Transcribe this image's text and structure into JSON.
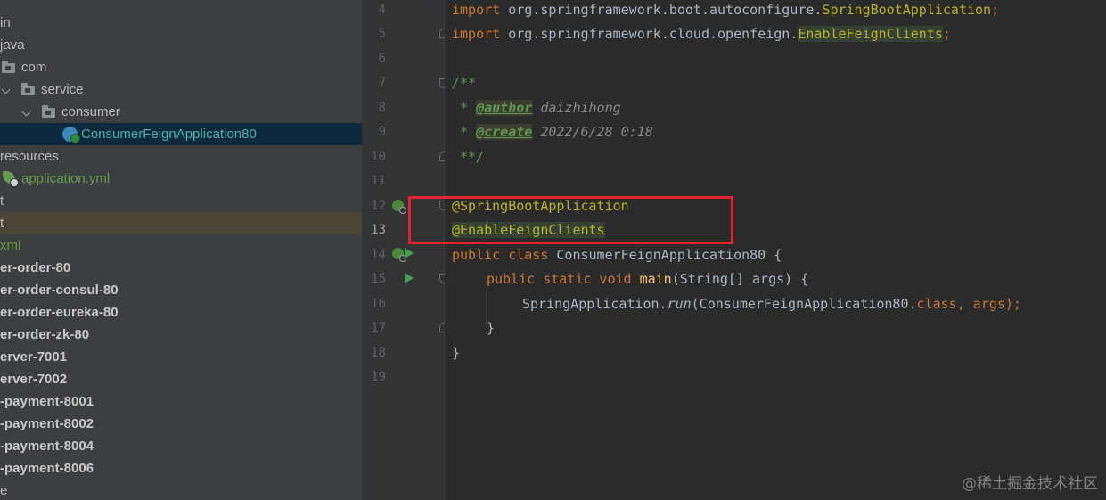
{
  "project_tree": {
    "rows": [
      {
        "text": "in",
        "style": "normal"
      },
      {
        "text": "java",
        "style": "normal"
      },
      {
        "text": "com",
        "style": "normal",
        "icon": "folder-icon"
      },
      {
        "text": "service",
        "style": "normal",
        "icon": "folder-icon"
      },
      {
        "text": "consumer",
        "style": "normal",
        "icon": "folder-icon"
      },
      {
        "text": "ConsumerFeignApplication80",
        "style": "selected",
        "icon": "spring-boot-class-icon"
      },
      {
        "text": "resources",
        "style": "normal"
      },
      {
        "text": "application.yml",
        "style": "green",
        "icon": "spring-config-icon"
      },
      {
        "text": "t",
        "style": "normal"
      },
      {
        "text": "t",
        "style": "highlighted"
      },
      {
        "text": "xml",
        "style": "green"
      },
      {
        "text": "er-order-80",
        "style": "bold"
      },
      {
        "text": "er-order-consul-80",
        "style": "bold"
      },
      {
        "text": "er-order-eureka-80",
        "style": "bold"
      },
      {
        "text": "er-order-zk-80",
        "style": "bold"
      },
      {
        "text": "erver-7001",
        "style": "bold"
      },
      {
        "text": "erver-7002",
        "style": "bold"
      },
      {
        "text": "-payment-8001",
        "style": "bold"
      },
      {
        "text": "-payment-8002",
        "style": "bold"
      },
      {
        "text": "-payment-8004",
        "style": "bold"
      },
      {
        "text": "-payment-8006",
        "style": "bold"
      },
      {
        "text": "e",
        "style": "normal"
      }
    ]
  },
  "editor": {
    "line_numbers": [
      "4",
      "5",
      "6",
      "7",
      "8",
      "9",
      "10",
      "11",
      "12",
      "13",
      "14",
      "15",
      "16",
      "17",
      "18",
      "19"
    ],
    "line4": {
      "kw": "import",
      "pkg": " org.springframework.boot.autoconfigure.",
      "cls": "SpringBootApplication",
      "semi": ";"
    },
    "line5": {
      "kw": "import",
      "pkg": " org.springframework.cloud.openfeign.",
      "cls": "EnableFeignClients",
      "semi": ";"
    },
    "line7": {
      "text": "/**"
    },
    "line8": {
      "star": " * ",
      "tag": "@author",
      "value": " daizhihong"
    },
    "line9": {
      "star": " * ",
      "tag": "@create",
      "value": " 2022/6/28 0:18"
    },
    "line10": {
      "text": " **/"
    },
    "line12": {
      "text": "@SpringBootApplication"
    },
    "line13": {
      "text": "@EnableFeignClients"
    },
    "line14": {
      "kw": "public class",
      "name": " ConsumerFeignApplication80 {"
    },
    "line15": {
      "kw": "public static void",
      "fn": "main",
      "rest": "(String[] args) {"
    },
    "line16": {
      "cls": "SpringApplication.",
      "fn": "run",
      "args": "(ConsumerFeignApplication80.",
      "kw": "class",
      "end": ", args);"
    },
    "line17": {
      "text": "}"
    },
    "line18": {
      "text": "}"
    }
  },
  "highlight_box_color": "#e8232f",
  "watermark": "@稀土掘金技术社区"
}
